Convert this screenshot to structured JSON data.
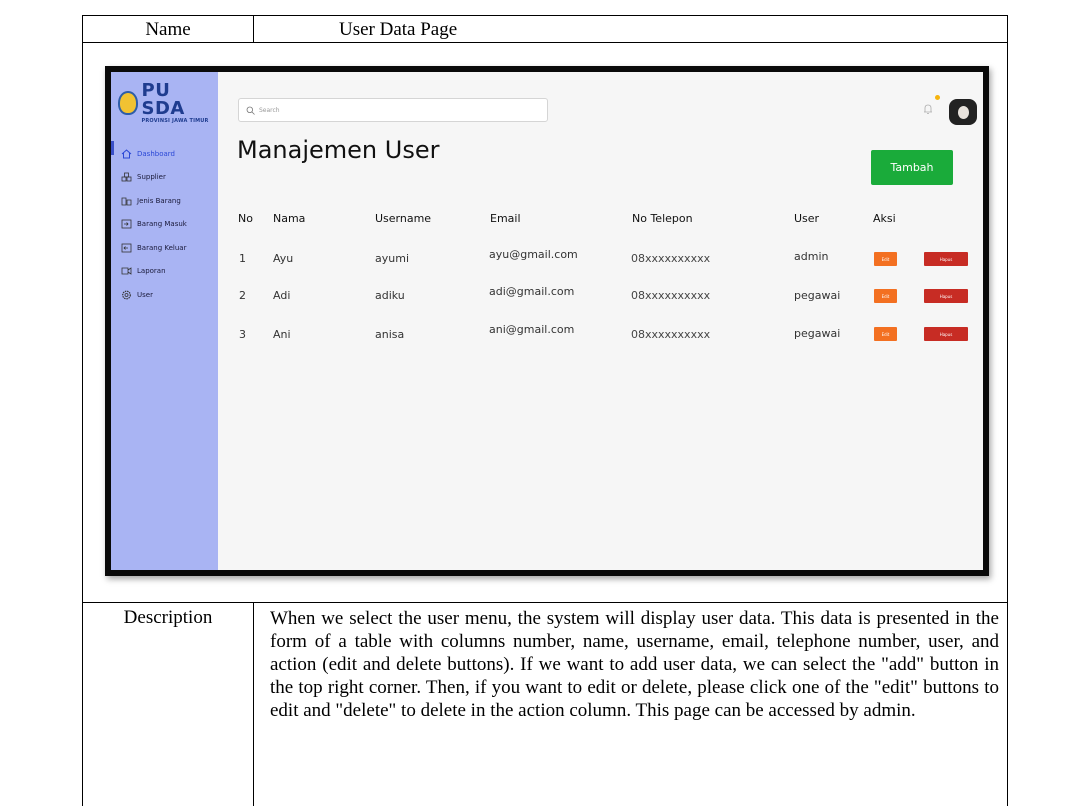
{
  "doc": {
    "name_label": "Name",
    "name_value": "User Data Page",
    "description_label": "Description",
    "description_text": "When we select the user menu, the system will display user data. This data is presented in the form of a table with columns number, name, username, email, telephone number, user, and action (edit and delete buttons). If we want to add user data, we can select the \"add\" button in the top right corner. Then, if you want to edit or delete, please click one of the \"edit\" buttons to edit and \"delete\" to delete in the action column. This page can be accessed by admin."
  },
  "app": {
    "logo_text": "PU SDA",
    "logo_subtext": "PROVINSI JAWA TIMUR",
    "search_placeholder": "Search",
    "page_title": "Manajemen User",
    "add_button_label": "Tambah",
    "sidebar": [
      {
        "label": "Dashboard",
        "icon": "home-icon",
        "active": true
      },
      {
        "label": "Supplier",
        "icon": "supplier-icon",
        "active": false
      },
      {
        "label": "Jenis Barang",
        "icon": "item-type-icon",
        "active": false
      },
      {
        "label": "Barang Masuk",
        "icon": "inbound-icon",
        "active": false
      },
      {
        "label": "Barang Keluar",
        "icon": "outbound-icon",
        "active": false
      },
      {
        "label": "Laporan",
        "icon": "report-icon",
        "active": false
      },
      {
        "label": "User",
        "icon": "gear-icon",
        "active": false
      }
    ],
    "table": {
      "headers": [
        "No",
        "Nama",
        "Username",
        "Email",
        "No Telepon",
        "User",
        "Aksi"
      ],
      "rows": [
        {
          "no": "1",
          "nama": "Ayu",
          "username": "ayumi",
          "email": "ayu@gmail.com",
          "telepon": "08xxxxxxxxxx",
          "user": "admin"
        },
        {
          "no": "2",
          "nama": "Adi",
          "username": "adiku",
          "email": "adi@gmail.com",
          "telepon": "08xxxxxxxxxx",
          "user": "pegawai"
        },
        {
          "no": "3",
          "nama": "Ani",
          "username": "anisa",
          "email": "ani@gmail.com",
          "telepon": "08xxxxxxxxxx",
          "user": "pegawai"
        }
      ],
      "edit_label": "Edit",
      "delete_label": "Hapus"
    },
    "colors": {
      "sidebar": "#a9b4f3",
      "add_button": "#1aab3a",
      "edit_button": "#f37021",
      "delete_button": "#c72c24"
    }
  }
}
